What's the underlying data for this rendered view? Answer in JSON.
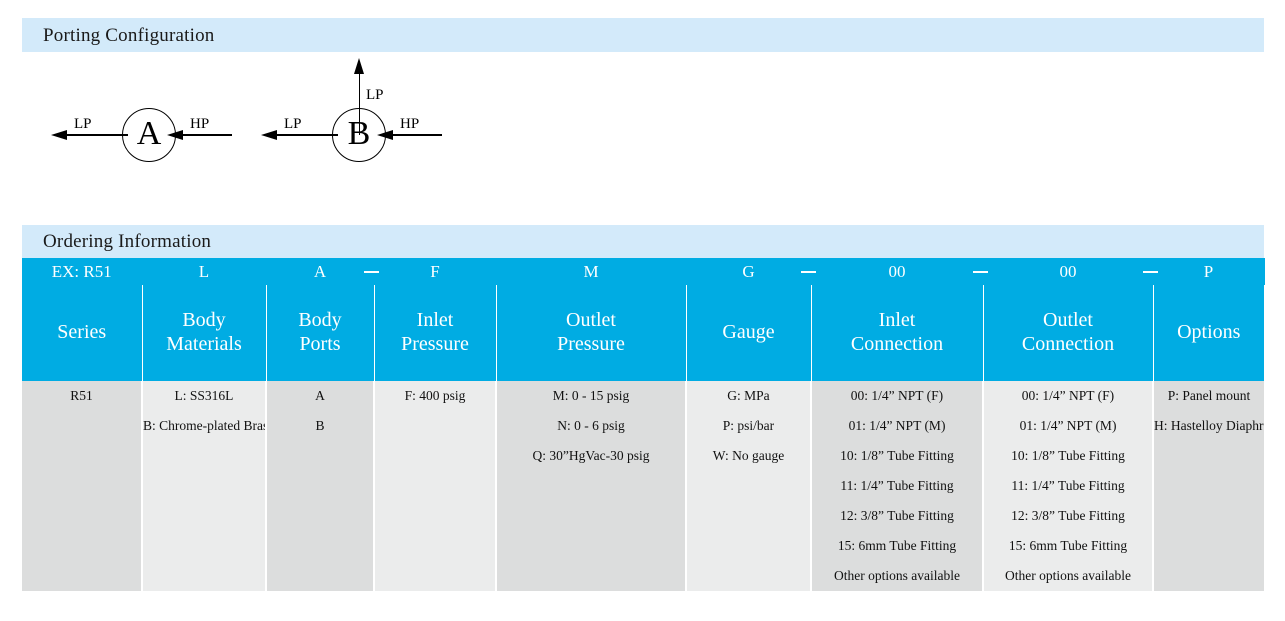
{
  "sections": {
    "porting": {
      "title": "Porting Configuration"
    },
    "ordering": {
      "title": "Ordering Information"
    }
  },
  "porting_configuration": {
    "diagrams": [
      {
        "id": "A",
        "body_label": "A",
        "ports": [
          {
            "name": "left-outlet",
            "label": "LP",
            "direction": "left"
          },
          {
            "name": "right-inlet",
            "label": "HP",
            "direction": "left"
          }
        ]
      },
      {
        "id": "B",
        "body_label": "B",
        "ports": [
          {
            "name": "left-outlet",
            "label": "LP",
            "direction": "left"
          },
          {
            "name": "right-inlet",
            "label": "HP",
            "direction": "left"
          },
          {
            "name": "top-outlet",
            "label": "LP",
            "direction": "up"
          }
        ]
      }
    ]
  },
  "ordering_information": {
    "example_row_prefix": "EX:",
    "separator": "–",
    "example_code": [
      "EX:  R51",
      "L",
      "A",
      "F",
      "M",
      "G",
      "00",
      "00",
      "P"
    ],
    "columns": [
      {
        "key": "series",
        "header": "Series",
        "example": "EX:  R51",
        "separator_before": false,
        "options": [
          "R51"
        ]
      },
      {
        "key": "body_materials",
        "header": "Body\nMaterials",
        "header_line1": "Body",
        "header_line2": "Materials",
        "example": "L",
        "separator_before": false,
        "options": [
          "L: SS316L",
          "B: Chrome-plated Brass"
        ]
      },
      {
        "key": "body_ports",
        "header_line1": "Body",
        "header_line2": "Ports",
        "example": "A",
        "separator_before": false,
        "options": [
          "A",
          "B"
        ]
      },
      {
        "key": "inlet_pressure",
        "header_line1": "Inlet",
        "header_line2": "Pressure",
        "example": "F",
        "separator_before": true,
        "options": [
          "F: 400 psig"
        ]
      },
      {
        "key": "outlet_pressure",
        "header_line1": "Outlet",
        "header_line2": "Pressure",
        "example": "M",
        "separator_before": false,
        "options": [
          "M: 0 - 15  psig",
          "N: 0 - 6  psig",
          "Q: 30”HgVac-30 psig"
        ]
      },
      {
        "key": "gauge",
        "header_line1": "Gauge",
        "header_line2": "",
        "example": "G",
        "separator_before": false,
        "options": [
          "G: MPa",
          "P: psi/bar",
          "W: No gauge"
        ]
      },
      {
        "key": "inlet_connection",
        "header_line1": "Inlet",
        "header_line2": "Connection",
        "example": "00",
        "separator_before": true,
        "options": [
          "00: 1/4” NPT (F)",
          "01: 1/4” NPT (M)",
          "10: 1/8” Tube Fitting",
          "11: 1/4” Tube Fitting",
          "12: 3/8” Tube Fitting",
          "15: 6mm Tube Fitting",
          "Other options available"
        ]
      },
      {
        "key": "outlet_connection",
        "header_line1": "Outlet",
        "header_line2": "Connection",
        "example": "00",
        "separator_before": true,
        "options": [
          "00: 1/4” NPT (F)",
          "01: 1/4” NPT (M)",
          "10: 1/8” Tube Fitting",
          "11: 1/4” Tube Fitting",
          "12: 3/8” Tube Fitting",
          "15: 6mm Tube Fitting",
          "Other options available"
        ]
      },
      {
        "key": "options",
        "header_line1": "Options",
        "header_line2": "",
        "example": "P",
        "separator_before": true,
        "options": [
          "P: Panel mount",
          "H: Hastelloy Diaphragm"
        ]
      }
    ],
    "option_rows": [
      [
        "R51",
        "L: SS316L",
        "A",
        "F: 400 psig",
        "M: 0 - 15  psig",
        "G: MPa",
        "00: 1/4” NPT (F)",
        "00: 1/4” NPT (F)",
        "P: Panel mount"
      ],
      [
        "",
        "B: Chrome-plated Brass",
        "B",
        "",
        "N: 0 - 6  psig",
        "P: psi/bar",
        "01: 1/4” NPT (M)",
        "01: 1/4” NPT (M)",
        "H: Hastelloy Diaphragm"
      ],
      [
        "",
        "",
        "",
        "",
        "Q: 30”HgVac-30 psig",
        "W: No gauge",
        "10: 1/8” Tube Fitting",
        "10: 1/8” Tube Fitting",
        ""
      ],
      [
        "",
        "",
        "",
        "",
        "",
        "",
        "11: 1/4” Tube Fitting",
        "11: 1/4” Tube Fitting",
        ""
      ],
      [
        "",
        "",
        "",
        "",
        "",
        "",
        "12: 3/8” Tube Fitting",
        "12: 3/8” Tube Fitting",
        ""
      ],
      [
        "",
        "",
        "",
        "",
        "",
        "",
        "15: 6mm Tube Fitting",
        "15: 6mm Tube Fitting",
        ""
      ],
      [
        "",
        "",
        "",
        "",
        "",
        "",
        "Other options available",
        "Other options available",
        ""
      ]
    ]
  },
  "colors": {
    "section_bar": "#d3eafa",
    "table_header": "#00ace3",
    "shade_dark": "#dcdddd",
    "shade_light": "#ebecec",
    "text_on_header": "#ffffff"
  }
}
